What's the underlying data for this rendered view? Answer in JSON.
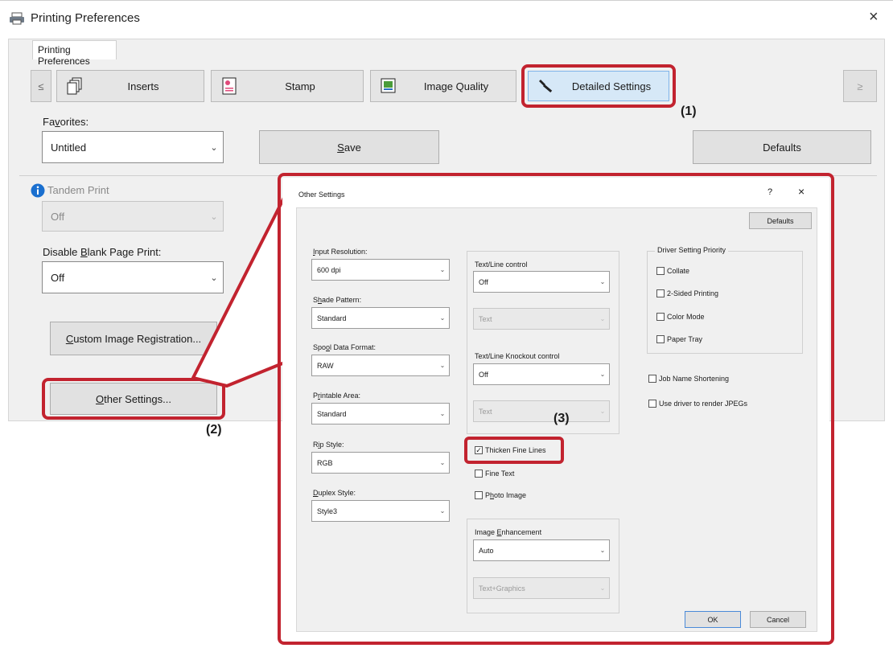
{
  "window": {
    "title": "Printing Preferences",
    "close_glyph": "×",
    "main_tab": "Printing Preferences"
  },
  "tabs": {
    "prev": "≤",
    "next": "≥",
    "items": [
      {
        "label": "Inserts",
        "icon": "inserts-icon"
      },
      {
        "label": "Stamp",
        "icon": "stamp-icon"
      },
      {
        "label": "Image Quality",
        "icon": "image-quality-icon"
      },
      {
        "label": "Detailed Settings",
        "icon": "wrench-icon",
        "active": true
      }
    ]
  },
  "favorites": {
    "label_pre": "Fa",
    "label_u": "v",
    "label_post": "orites:",
    "value": "Untitled",
    "save_pre": "",
    "save_u": "S",
    "save_post": "ave",
    "defaults": "Defaults"
  },
  "left": {
    "tandem_label": "Tandem Print",
    "tandem_value": "Off",
    "blank_pre": "Disable ",
    "blank_u": "B",
    "blank_post": "lank Page Print:",
    "blank_value": "Off",
    "custom_u": "C",
    "custom_post": "ustom Image Registration...",
    "other_u": "O",
    "other_post": "ther Settings..."
  },
  "callouts": {
    "c1": "(1)",
    "c2": "(2)",
    "c3": "(3)"
  },
  "dialog": {
    "title": "Other Settings",
    "help": "?",
    "close": "×",
    "defaults": "Defaults",
    "input_resolution": {
      "label_u": "I",
      "label_post": "nput Resolution:",
      "value": "600 dpi"
    },
    "shade_pattern": {
      "label_pre": "S",
      "label_u": "h",
      "label_post": "ade Pattern:",
      "value": "Standard"
    },
    "spool": {
      "label_pre": "Spo",
      "label_u": "o",
      "label_post": "l Data Format:",
      "value": "RAW"
    },
    "printable": {
      "label_pre": "P",
      "label_u": "r",
      "label_post": "intable Area:",
      "value": "Standard"
    },
    "rip": {
      "label_pre": "R",
      "label_u": "i",
      "label_post": "p Style:",
      "value": "RGB"
    },
    "duplex": {
      "label_u": "D",
      "label_post": "uplex Style:",
      "value": "Style3"
    },
    "text_line_control": {
      "label": "Text/Line control",
      "value": "Off",
      "sub_value": "Text"
    },
    "text_line_knockout": {
      "label": "Text/Line Knockout control",
      "value": "Off",
      "sub_value": "Text"
    },
    "thicken": {
      "label": "Thicken Fine Lines",
      "checked": true
    },
    "fine_text": {
      "label": "Fine Text",
      "checked": false
    },
    "photo_image": {
      "label_pre": "P",
      "label_u": "h",
      "label_post": "oto Image",
      "checked": false
    },
    "image_enhancement": {
      "label_pre": "Image ",
      "label_u": "E",
      "label_post": "nhancement",
      "value": "Auto",
      "sub_value": "Text+Graphics"
    },
    "driver_priority": {
      "title": "Driver Setting Priority",
      "items": [
        "Collate",
        "2-Sided Printing",
        "Color Mode",
        "Paper Tray"
      ]
    },
    "job_name": "Job Name Shortening",
    "use_driver": "Use driver to render JPEGs",
    "ok": "OK",
    "cancel": "Cancel"
  },
  "colors": {
    "highlight_red": "#c2232f",
    "active_tab": "#d6e8f7",
    "info_blue": "#1a6fcf"
  }
}
